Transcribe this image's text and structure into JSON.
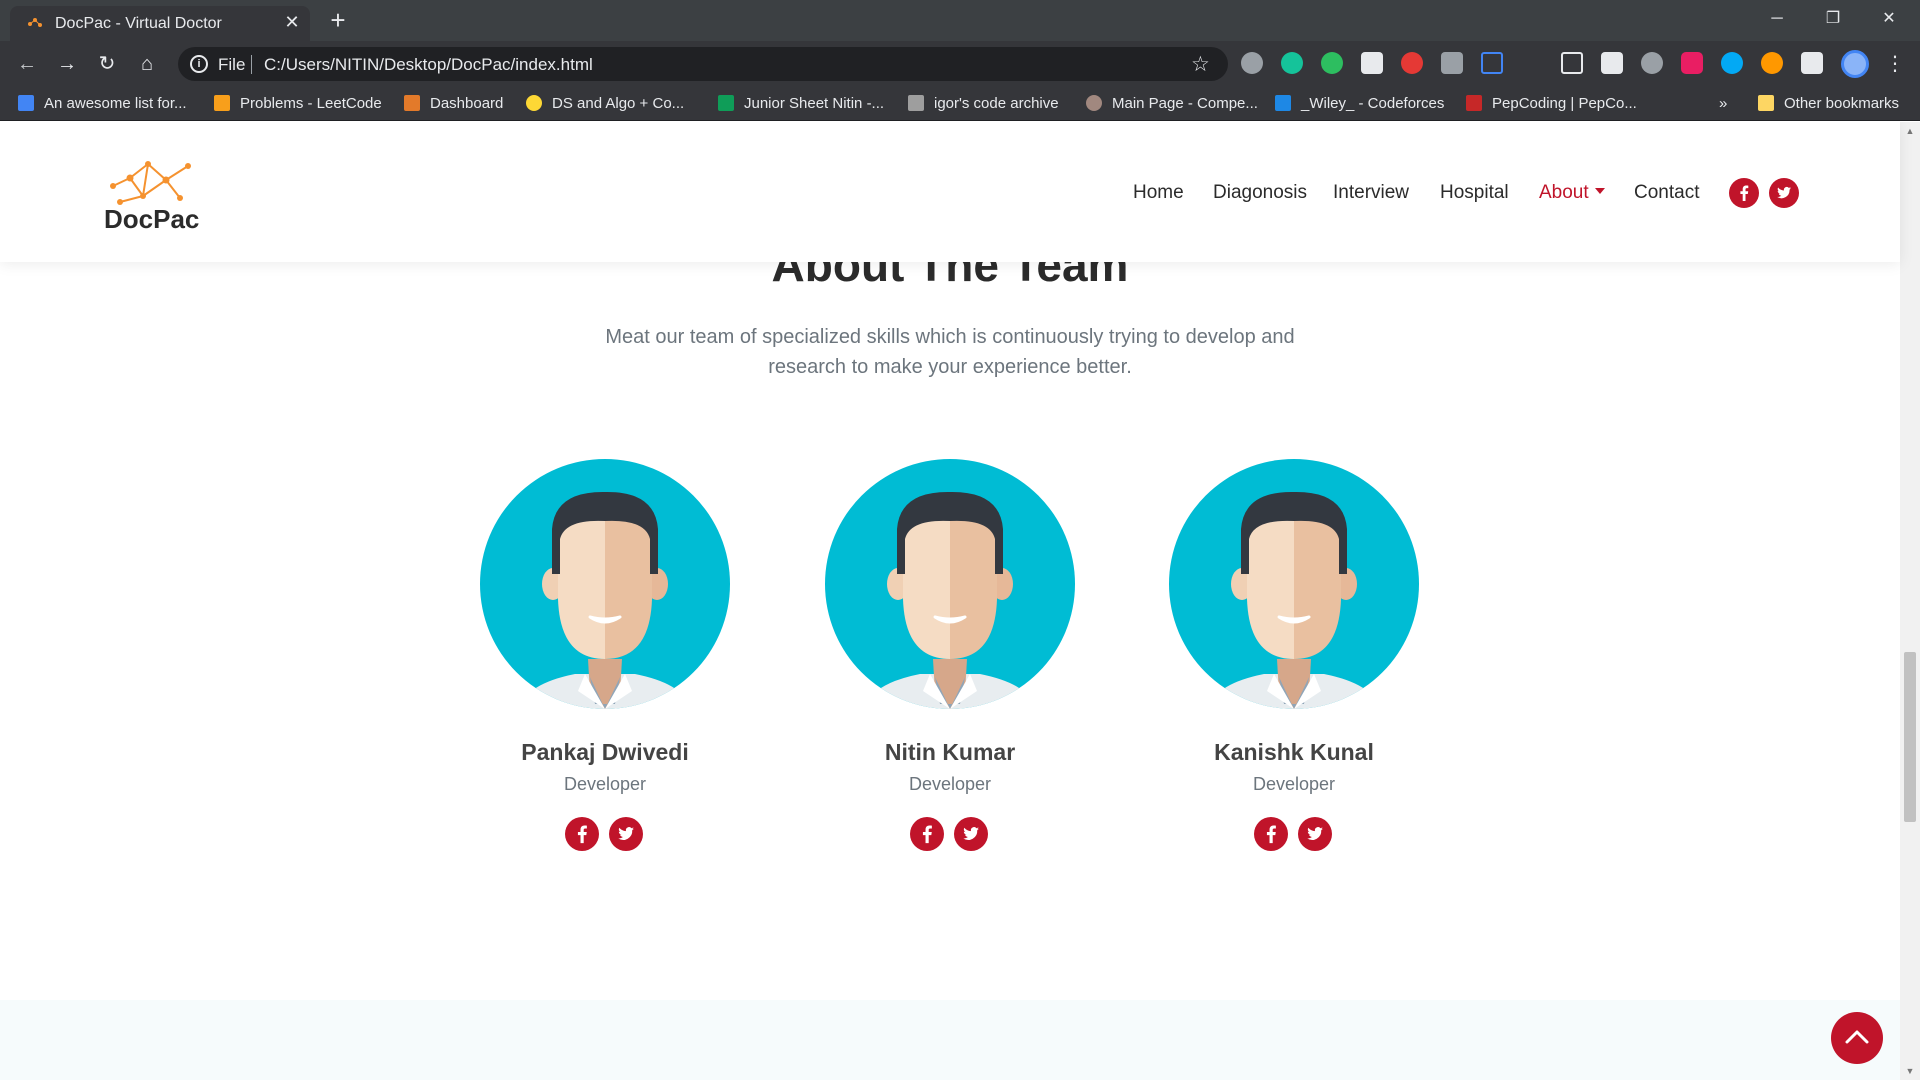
{
  "browser": {
    "tab_title": "DocPac - Virtual Doctor",
    "new_tab": "+",
    "url_scheme": "File",
    "url": "C:/Users/NITIN/Desktop/DocPac/index.html",
    "bookmarks": [
      {
        "label": "An awesome list for...",
        "icon_color": "#4285f4"
      },
      {
        "label": "Problems - LeetCode",
        "icon_color": "#f89f1b"
      },
      {
        "label": "Dashboard",
        "icon_color": "#e37a2a"
      },
      {
        "label": "DS and Algo + Co...",
        "icon_color": "#fdd835"
      },
      {
        "label": "Junior Sheet Nitin -...",
        "icon_color": "#0f9d58"
      },
      {
        "label": "igor's code archive",
        "icon_color": "#9e9e9e"
      },
      {
        "label": "Main Page - Compe...",
        "icon_color": "#a1887f"
      },
      {
        "label": "_Wiley_ - Codeforces",
        "icon_color": "#1e88e5"
      },
      {
        "label": "PepCoding | PepCo...",
        "icon_color": "#c62828"
      }
    ],
    "bookmarks_overflow": "»",
    "other_bookmarks": "Other bookmarks"
  },
  "site": {
    "logo_text": "DocPac",
    "brand_color": "#c0142a",
    "logo_color": "#f5922f",
    "nav": [
      {
        "label": "Home"
      },
      {
        "label": "Diagonosis"
      },
      {
        "label": "Interview"
      },
      {
        "label": "Hospital"
      },
      {
        "label": "About",
        "active": true
      },
      {
        "label": "Contact"
      }
    ]
  },
  "team": {
    "title": "About The Team",
    "subtitle": "Meat our team of specialized skills which is continuously trying to develop and research to make your experience better.",
    "members": [
      {
        "name": "Pankaj Dwivedi",
        "role": "Developer"
      },
      {
        "name": "Nitin Kumar",
        "role": "Developer"
      },
      {
        "name": "Kanishk Kunal",
        "role": "Developer"
      }
    ],
    "avatar_bg": "#00bcd4"
  }
}
